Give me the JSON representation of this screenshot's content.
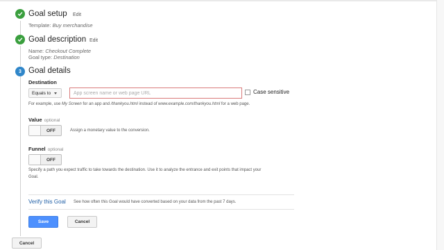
{
  "steps": [
    {
      "title": "Goal setup",
      "edit_label": "Edit",
      "status": "done",
      "meta": [
        {
          "label": "Template:",
          "value": "Buy merchandise"
        }
      ]
    },
    {
      "title": "Goal description",
      "edit_label": "Edit",
      "status": "done",
      "meta": [
        {
          "label": "Name:",
          "value": "Checkout Complete"
        },
        {
          "label": "Goal type:",
          "value": "Destination"
        }
      ]
    },
    {
      "number": "3",
      "title": "Goal details",
      "status": "active"
    }
  ],
  "destination": {
    "label": "Destination",
    "match_type": "Equals to",
    "url_value": "",
    "url_placeholder": "App screen name or web page URL",
    "case_sensitive_label": "Case sensitive",
    "case_sensitive_checked": false,
    "help": {
      "prefix": "For example, use",
      "ex1": "My Screen",
      "mid1": "for an app and",
      "ex2": "/thankyou.html",
      "mid2": "instead of",
      "ex3": "www.example.com/thankyou.html",
      "suffix": "for a web page."
    }
  },
  "value": {
    "label": "Value",
    "optional": "optional",
    "toggle_state": "OFF",
    "description": "Assign a monetary value to the conversion."
  },
  "funnel": {
    "label": "Funnel",
    "optional": "optional",
    "toggle_state": "OFF",
    "description_line1": "Specify a path you expect traffic to take towards the destination. Use it to analyze the entrance and exit points that impact your",
    "description_line2": "Goal."
  },
  "verify": {
    "link": "Verify this Goal",
    "description": "See how often this Goal would have converted based on your data from the past 7 days."
  },
  "actions": {
    "save": "Save",
    "cancel": "Cancel",
    "bottom_cancel": "Cancel"
  },
  "colors": {
    "done": "#3a9f3e",
    "active": "#2f86c9",
    "primary": "#4d90fe",
    "link": "#1f5fa6",
    "error_border": "#d97a7a"
  }
}
